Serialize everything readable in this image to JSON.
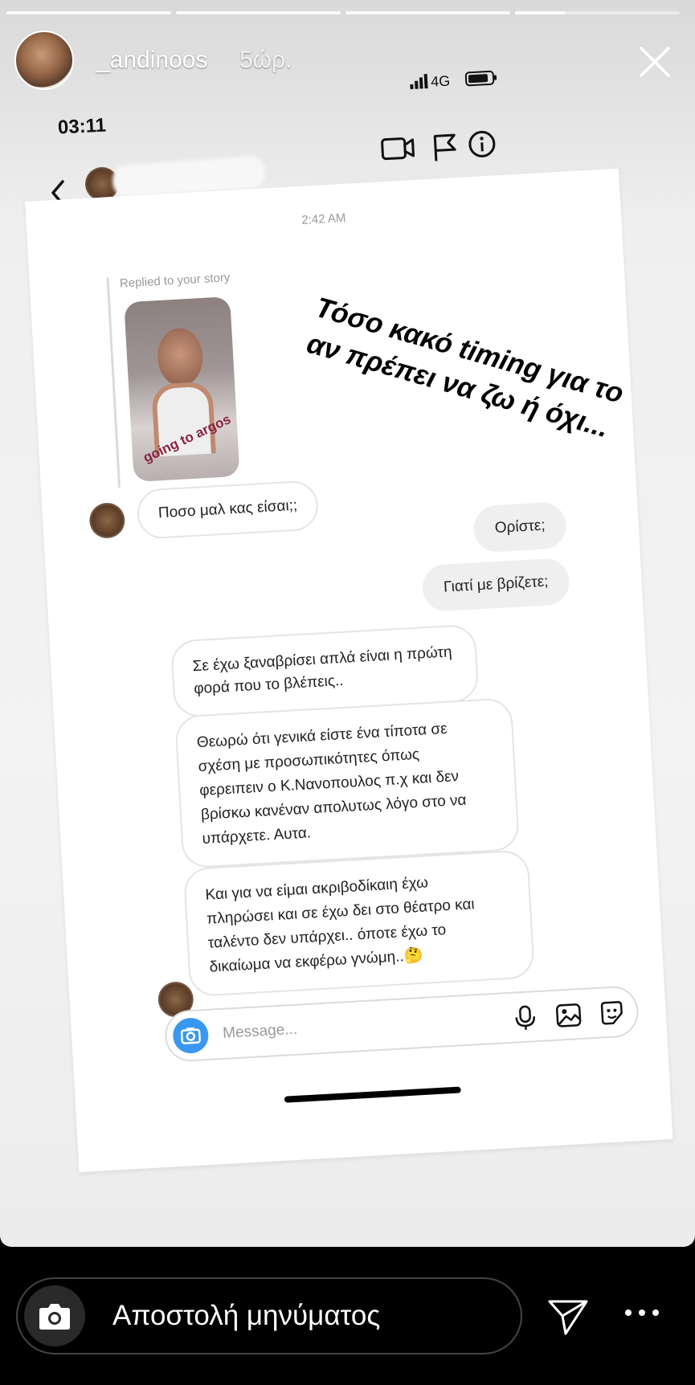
{
  "story": {
    "username": "_andinoos",
    "time_ago": "5ώρ.",
    "progress_segments": [
      1,
      1,
      1,
      0.3
    ],
    "overlay_text_lines": [
      "Τόσο κακό timing για το",
      "αν πρέπει να ζω ή όχι..."
    ]
  },
  "screenshot": {
    "clock": "03:11",
    "network": "4G",
    "dm": {
      "timestamp": "2:42 AM",
      "replied_label": "Replied to your story",
      "story_thumbnail_caption": "going to argos",
      "messages": [
        {
          "from": "them",
          "text": "Ποσο μαλ  κας είσαι;;"
        },
        {
          "from": "me",
          "text": "Ορίστε;"
        },
        {
          "from": "me",
          "text": "Γιατί με βρίζετε;"
        },
        {
          "from": "them",
          "lines": [
            "Σε έχω ξαναβρίσει απλά είναι η πρώτη",
            "φορά που το βλέπεις.."
          ]
        },
        {
          "from": "them",
          "lines": [
            "Θεωρώ ότι γενικά είστε ένα τίποτα σε",
            "σχέση με προσωπικότητες όπως",
            "φερειπειν ο Κ.Νανοπουλος π.χ και δεν",
            "βρίσκω κανέναν απολυτως λόγο στο να",
            "υπάρχετε. Αυτα."
          ]
        },
        {
          "from": "them",
          "lines": [
            "Και για να είμαι ακριβοδίκαιη έχω",
            "πληρώσει και σε έχω δει στο θέατρο και",
            "ταλέντο δεν υπάρχει.. όποτε έχω το",
            "δικαίωμα να εκφέρω γνώμη..",
            "🤔"
          ]
        }
      ],
      "composer_placeholder": "Message..."
    }
  },
  "reply": {
    "placeholder": "Αποστολή μηνύματος"
  },
  "colors": {
    "dm_blue": "#3897f0",
    "bubble_gray": "#efefef",
    "bubble_border": "#e4e4e4"
  }
}
